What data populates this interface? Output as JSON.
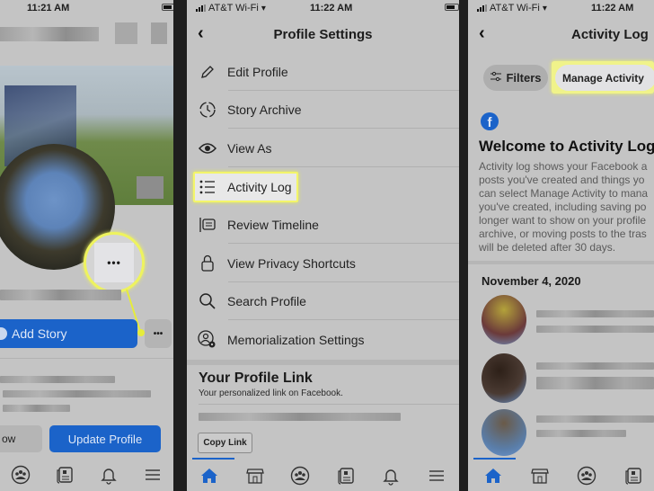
{
  "panel1": {
    "status_time": "11:21 AM",
    "add_story_label": "Add Story",
    "more_label": "•••",
    "callout_more_label": "•••",
    "left_button_label": "ow",
    "update_profile_label": "Update Profile",
    "tabs": [
      "groups-icon",
      "news-icon",
      "bell-icon",
      "menu-icon"
    ]
  },
  "panel2": {
    "carrier": "AT&T Wi-Fi",
    "status_time": "11:22 AM",
    "title": "Profile Settings",
    "menu": [
      {
        "label": "Edit Profile",
        "icon": "pencil-icon"
      },
      {
        "label": "Story Archive",
        "icon": "clock-icon"
      },
      {
        "label": "View As",
        "icon": "eye-icon"
      },
      {
        "label": "Activity Log",
        "icon": "list-icon",
        "highlighted": true
      },
      {
        "label": "Review Timeline",
        "icon": "timeline-icon"
      },
      {
        "label": "View Privacy Shortcuts",
        "icon": "lock-icon"
      },
      {
        "label": "Search Profile",
        "icon": "search-icon"
      },
      {
        "label": "Memorialization Settings",
        "icon": "user-gear-icon"
      }
    ],
    "profile_link_title": "Your Profile Link",
    "profile_link_subtitle": "Your personalized link on Facebook.",
    "copy_link_label": "Copy Link",
    "tabs": [
      "home-icon",
      "marketplace-icon",
      "groups-icon",
      "news-icon",
      "bell-icon",
      "menu-icon"
    ]
  },
  "panel3": {
    "carrier": "AT&T Wi-Fi",
    "status_time": "11:22 AM",
    "title": "Activity Log",
    "filters_label": "Filters",
    "manage_activity_label": "Manage Activity",
    "welcome_title": "Welcome to Activity Log",
    "welcome_lines": [
      "Activity log shows your Facebook a",
      "posts you've created and things yo",
      "can select Manage Activity to mana",
      "you've created, including saving po",
      "longer want to show on your profile",
      "archive, or moving posts to the tras",
      "will be deleted after 30 days."
    ],
    "date_heading": "November 4, 2020",
    "tabs": [
      "home-icon",
      "marketplace-icon",
      "groups-icon",
      "news-icon"
    ]
  },
  "colors": {
    "fb_blue": "#1b63c9",
    "highlight_yellow": "#f3f56a",
    "screen_bg": "#c4c4c4"
  }
}
